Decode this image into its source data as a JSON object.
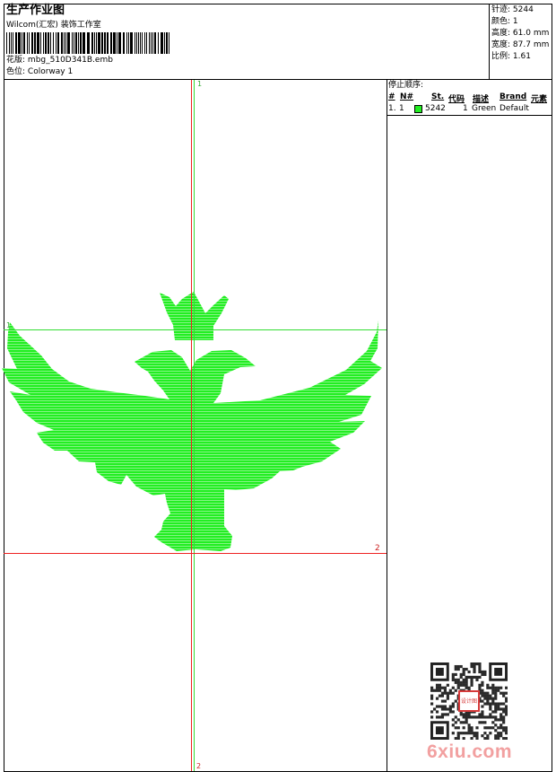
{
  "header": {
    "title": "生产作业图",
    "subtitle": "Wilcom(汇宏) 装饰工作室",
    "design_label": "花版:",
    "design_file": "mbg_510D341B.emb",
    "colorway_label": "色位:",
    "colorway": "Colorway 1"
  },
  "stats": [
    {
      "label": "针迹:",
      "value": "5244"
    },
    {
      "label": "颜色:",
      "value": "1"
    },
    {
      "label": "高度:",
      "value": "61.0 mm"
    },
    {
      "label": "宽度:",
      "value": "87.7 mm"
    },
    {
      "label": "比例:",
      "value": "1.61"
    }
  ],
  "stop_sequence": {
    "title": "停止顺序:",
    "columns": [
      "#",
      "N#",
      "St.",
      "代码",
      "描述",
      "Brand",
      "元素"
    ],
    "rows": [
      {
        "index": "1.",
        "needle": "1",
        "color": "#22ee22",
        "stitches": "5242",
        "code": "1",
        "description": "Green",
        "brand": "Default",
        "element": ""
      }
    ]
  },
  "guides": {
    "top_marker": "1",
    "left_marker": "1",
    "right_marker": "2",
    "bottom_marker": "2"
  },
  "colors": {
    "thread": "#22ee22",
    "guide_green": "#33dd33",
    "guide_red": "#ee2222"
  },
  "watermark": {
    "text": "6xiu.com",
    "seal_text": "设计图"
  }
}
